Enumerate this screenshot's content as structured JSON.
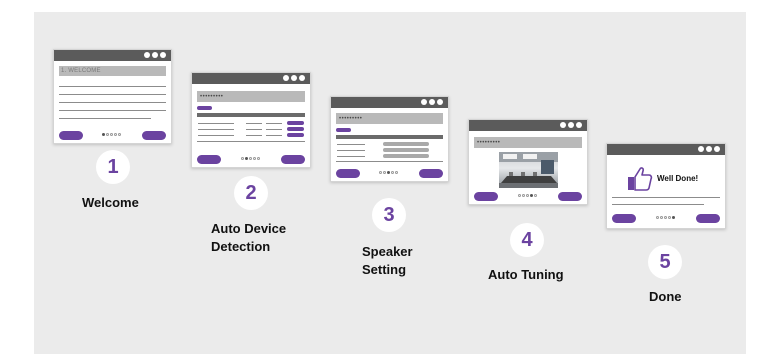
{
  "steps": [
    {
      "number": "1",
      "label_line1": "Welcome",
      "label_line2": "",
      "screen_title": "1. WELCOME"
    },
    {
      "number": "2",
      "label_line1": "Auto Device",
      "label_line2": "Detection",
      "screen_title": "•••••••••"
    },
    {
      "number": "3",
      "label_line1": "Speaker",
      "label_line2": "Setting",
      "screen_title": "•••••••••"
    },
    {
      "number": "4",
      "label_line1": "Auto Tuning",
      "label_line2": "",
      "screen_title": "•••••••••"
    },
    {
      "number": "5",
      "label_line1": "Done",
      "label_line2": "",
      "screen_title": "",
      "message": "Well Done!"
    }
  ],
  "colors": {
    "accent": "#6b43a0",
    "titlebar": "#5b5b5b",
    "panel": "#ebebeb",
    "bar": "#b9b9b9"
  },
  "icons": [
    "window-controls-icon",
    "thumbs-up-icon",
    "conference-room-image"
  ]
}
